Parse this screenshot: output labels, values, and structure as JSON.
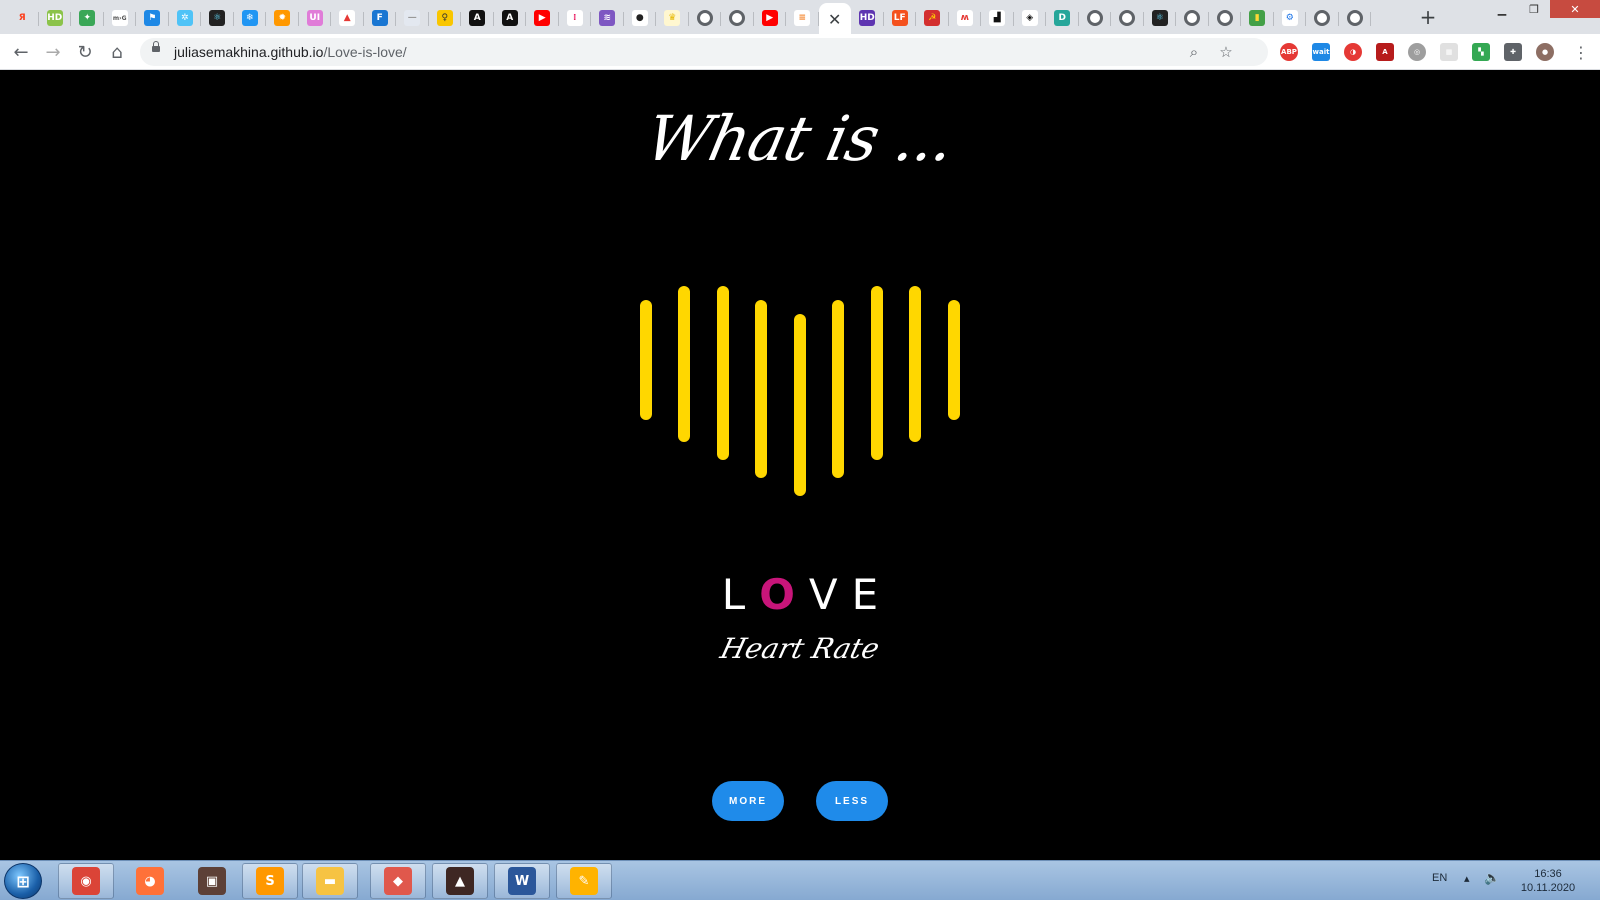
{
  "browser": {
    "tabs": [
      {
        "icon": "yandex-icon",
        "glyph": "Я",
        "color": "#fc3f1d",
        "text": "#fc3f1d",
        "bg": "transparent"
      },
      {
        "icon": "hd-icon",
        "glyph": "HD",
        "color": "#8bc34a",
        "text": "#fff"
      },
      {
        "icon": "puzzle-icon",
        "glyph": "✦",
        "color": "#3aa757",
        "text": "#fff"
      },
      {
        "icon": "mog-icon",
        "glyph": "m›G",
        "color": "#ffffff",
        "text": "#555"
      },
      {
        "icon": "flag-icon",
        "glyph": "⚑",
        "color": "#1e88e5",
        "text": "#fff"
      },
      {
        "icon": "gear-blue-icon",
        "glyph": "✲",
        "color": "#4fc3f7",
        "text": "#fff"
      },
      {
        "icon": "react-icon",
        "glyph": "⚛",
        "color": "#222",
        "text": "#61dafb"
      },
      {
        "icon": "snowflake-icon",
        "glyph": "❄",
        "color": "#2196f3",
        "text": "#fff"
      },
      {
        "icon": "sun-icon",
        "glyph": "✹",
        "color": "#ff9800",
        "text": "#fff"
      },
      {
        "icon": "ui-icon",
        "glyph": "UI",
        "color": "#e07cd8",
        "text": "#fff"
      },
      {
        "icon": "red-triangle-icon",
        "glyph": "▲",
        "color": "#ffffff",
        "text": "#e53935"
      },
      {
        "icon": "f-icon",
        "glyph": "F",
        "color": "#1976d2",
        "text": "#fff"
      },
      {
        "icon": "doc-icon",
        "glyph": "—",
        "color": "#e3e8f0",
        "text": "#999"
      },
      {
        "icon": "bulb-icon",
        "glyph": "♀",
        "color": "#f9c600",
        "text": "#333"
      },
      {
        "icon": "angular-black-icon",
        "glyph": "A",
        "color": "#111",
        "text": "#fff"
      },
      {
        "icon": "angular-black-icon",
        "glyph": "A",
        "color": "#111",
        "text": "#fff"
      },
      {
        "icon": "youtube-icon",
        "glyph": "▶",
        "color": "#ff0000",
        "text": "#fff"
      },
      {
        "icon": "dots-icon",
        "glyph": "⁞",
        "color": "#fff",
        "text": "#e91e63"
      },
      {
        "icon": "stack-icon",
        "glyph": "≋",
        "color": "#7e57c2",
        "text": "#fff"
      },
      {
        "icon": "github-icon",
        "glyph": "●",
        "color": "#fff",
        "text": "#222"
      },
      {
        "icon": "crown-icon",
        "glyph": "♛",
        "color": "#fff7d0",
        "text": "#e6b800"
      },
      {
        "icon": "globe-icon",
        "glyph": "",
        "color": "globe",
        "text": "#5f6368"
      },
      {
        "icon": "globe-icon",
        "glyph": "",
        "color": "globe",
        "text": "#5f6368"
      },
      {
        "icon": "youtube-icon",
        "glyph": "▶",
        "color": "#ff0000",
        "text": "#fff"
      },
      {
        "icon": "stackoverflow-icon",
        "glyph": "≡",
        "color": "#fff",
        "text": "#f48024"
      },
      {
        "icon": "close-tab-icon",
        "glyph": "✕",
        "color": "active",
        "text": "#3c4043"
      },
      {
        "icon": "hd-purple-icon",
        "glyph": "HD",
        "color": "#5e35b1",
        "text": "#fff"
      },
      {
        "icon": "lf-icon",
        "glyph": "LF",
        "color": "#f4511e",
        "text": "#fff"
      },
      {
        "icon": "hammer-icon",
        "glyph": "☭",
        "color": "#d32f2f",
        "text": "#ffd600"
      },
      {
        "icon": "swoosh-icon",
        "glyph": "ʍ",
        "color": "#fff",
        "text": "#e53935"
      },
      {
        "icon": "black-box-icon",
        "glyph": "▟",
        "color": "#fff",
        "text": "#111"
      },
      {
        "icon": "codepen-icon",
        "glyph": "◈",
        "color": "#fff",
        "text": "#111"
      },
      {
        "icon": "d-icon",
        "glyph": "D",
        "color": "#26a69a",
        "text": "#fff"
      },
      {
        "icon": "globe-icon",
        "glyph": "",
        "color": "globe",
        "text": "#5f6368"
      },
      {
        "icon": "globe-icon",
        "glyph": "",
        "color": "globe",
        "text": "#5f6368"
      },
      {
        "icon": "react-icon",
        "glyph": "⚛",
        "color": "#222",
        "text": "#61dafb"
      },
      {
        "icon": "globe-icon",
        "glyph": "",
        "color": "globe",
        "text": "#5f6368"
      },
      {
        "icon": "globe-icon",
        "glyph": "",
        "color": "globe",
        "text": "#5f6368"
      },
      {
        "icon": "bars-color-icon",
        "glyph": "▮",
        "color": "#43a047",
        "text": "#fdd835"
      },
      {
        "icon": "settings-icon",
        "glyph": "⚙",
        "color": "#fff",
        "text": "#1a73e8"
      },
      {
        "icon": "globe-icon",
        "glyph": "",
        "color": "globe",
        "text": "#5f6368"
      },
      {
        "icon": "globe-icon",
        "glyph": "",
        "color": "globe",
        "text": "#5f6368"
      }
    ],
    "url_host": "juliasemakhina.github.io",
    "url_path": "/Love-is-love/",
    "extensions": [
      {
        "icon": "adblock-icon",
        "glyph": "ABP",
        "color": "#e53935",
        "round": true
      },
      {
        "icon": "wait-icon",
        "glyph": "wait",
        "color": "#1e88e5",
        "round": false
      },
      {
        "icon": "red-swirl-icon",
        "glyph": "◑",
        "color": "#e53935",
        "round": true
      },
      {
        "icon": "pdf-icon",
        "glyph": "A",
        "color": "#b71c1c",
        "round": false
      },
      {
        "icon": "globe-grey-icon",
        "glyph": "◎",
        "color": "#9e9e9e",
        "round": true
      },
      {
        "icon": "grid-icon",
        "glyph": "▦",
        "color": "#e0e0e0",
        "round": false
      },
      {
        "icon": "google-icon",
        "glyph": "▚",
        "color": "#34a853",
        "round": false
      },
      {
        "icon": "extensions-puzzle-icon",
        "glyph": "✚",
        "color": "#5f6368",
        "round": false
      },
      {
        "icon": "profile-avatar-icon",
        "glyph": "●",
        "color": "#8d6e63",
        "round": true
      }
    ]
  },
  "page": {
    "title": "What is ...",
    "love_l": "L",
    "love_o": "O",
    "love_ve": "VE",
    "subtitle": "Heart Rate",
    "more_label": "MORE",
    "less_label": "LESS",
    "bar_color": "#ffd700",
    "accent_color": "#c8157a",
    "button_color": "#1f8bea"
  },
  "taskbar": {
    "apps": [
      {
        "icon": "chrome-icon",
        "glyph": "◉",
        "color": "#db4437",
        "pinned": true
      },
      {
        "icon": "firefox-icon",
        "glyph": "◕",
        "color": "#ff7139",
        "pinned": false
      },
      {
        "icon": "photo-viewer-icon",
        "glyph": "▣",
        "color": "#5d4037",
        "pinned": false
      },
      {
        "icon": "sublime-icon",
        "glyph": "S",
        "color": "#ff9800",
        "pinned": true
      },
      {
        "icon": "folder-icon",
        "glyph": "▬",
        "color": "#f6c343",
        "pinned": true
      },
      {
        "icon": "git-icon",
        "glyph": "◆",
        "color": "#e0584c",
        "pinned": true
      },
      {
        "icon": "media-icon",
        "glyph": "▲",
        "color": "#3e2723",
        "pinned": true
      },
      {
        "icon": "word-icon",
        "glyph": "W",
        "color": "#2b579a",
        "pinned": true
      },
      {
        "icon": "paint-icon",
        "glyph": "✎",
        "color": "#ffb300",
        "pinned": true
      }
    ],
    "lang": "EN",
    "time": "16:36",
    "date": "10.11.2020"
  }
}
